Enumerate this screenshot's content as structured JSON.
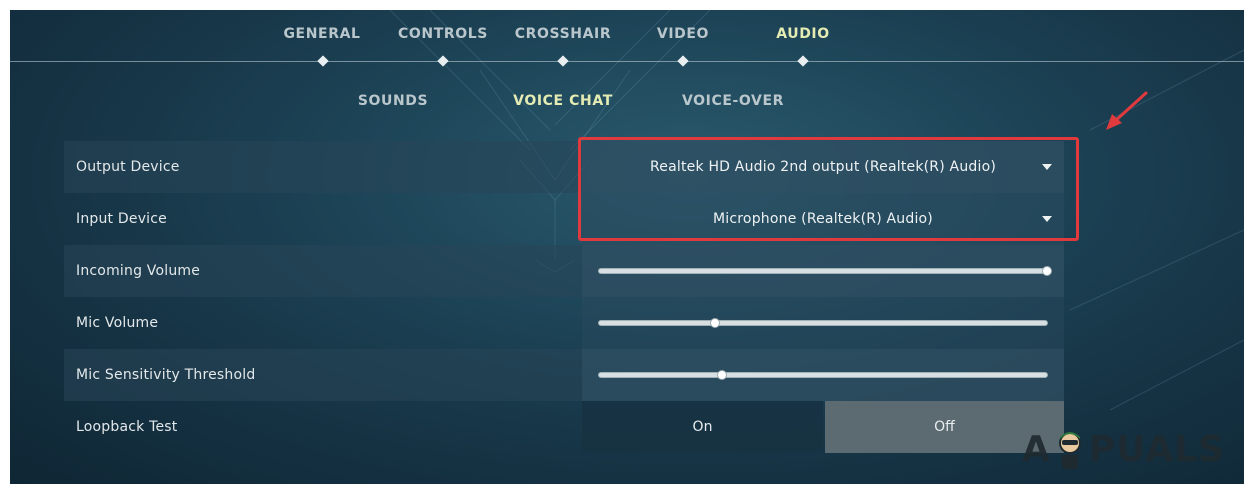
{
  "top_nav": {
    "tabs": [
      {
        "label": "GENERAL",
        "active": false
      },
      {
        "label": "CONTROLS",
        "active": false
      },
      {
        "label": "CROSSHAIR",
        "active": false
      },
      {
        "label": "VIDEO",
        "active": false
      },
      {
        "label": "AUDIO",
        "active": true
      }
    ]
  },
  "sub_nav": {
    "tabs": [
      {
        "label": "SOUNDS",
        "active": false
      },
      {
        "label": "VOICE CHAT",
        "active": true
      },
      {
        "label": "VOICE-OVER",
        "active": false
      }
    ]
  },
  "settings": {
    "output_device": {
      "label": "Output Device",
      "value": "Realtek HD Audio 2nd output (Realtek(R) Audio)"
    },
    "input_device": {
      "label": "Input Device",
      "value": "Microphone (Realtek(R) Audio)"
    },
    "incoming_volume": {
      "label": "Incoming Volume",
      "level": 1.0
    },
    "mic_volume": {
      "label": "Mic Volume",
      "level": 0.26
    },
    "mic_sensitivity": {
      "label": "Mic Sensitivity Threshold",
      "level": 0.275
    },
    "loopback_test": {
      "label": "Loopback Test",
      "on_label": "On",
      "off_label": "Off",
      "selected": "Off"
    }
  },
  "watermark": {
    "text_left": "A",
    "text_right": "PUALS"
  },
  "colors": {
    "accent_active": "#e4ecb3",
    "annotation": "#e03a3e"
  }
}
